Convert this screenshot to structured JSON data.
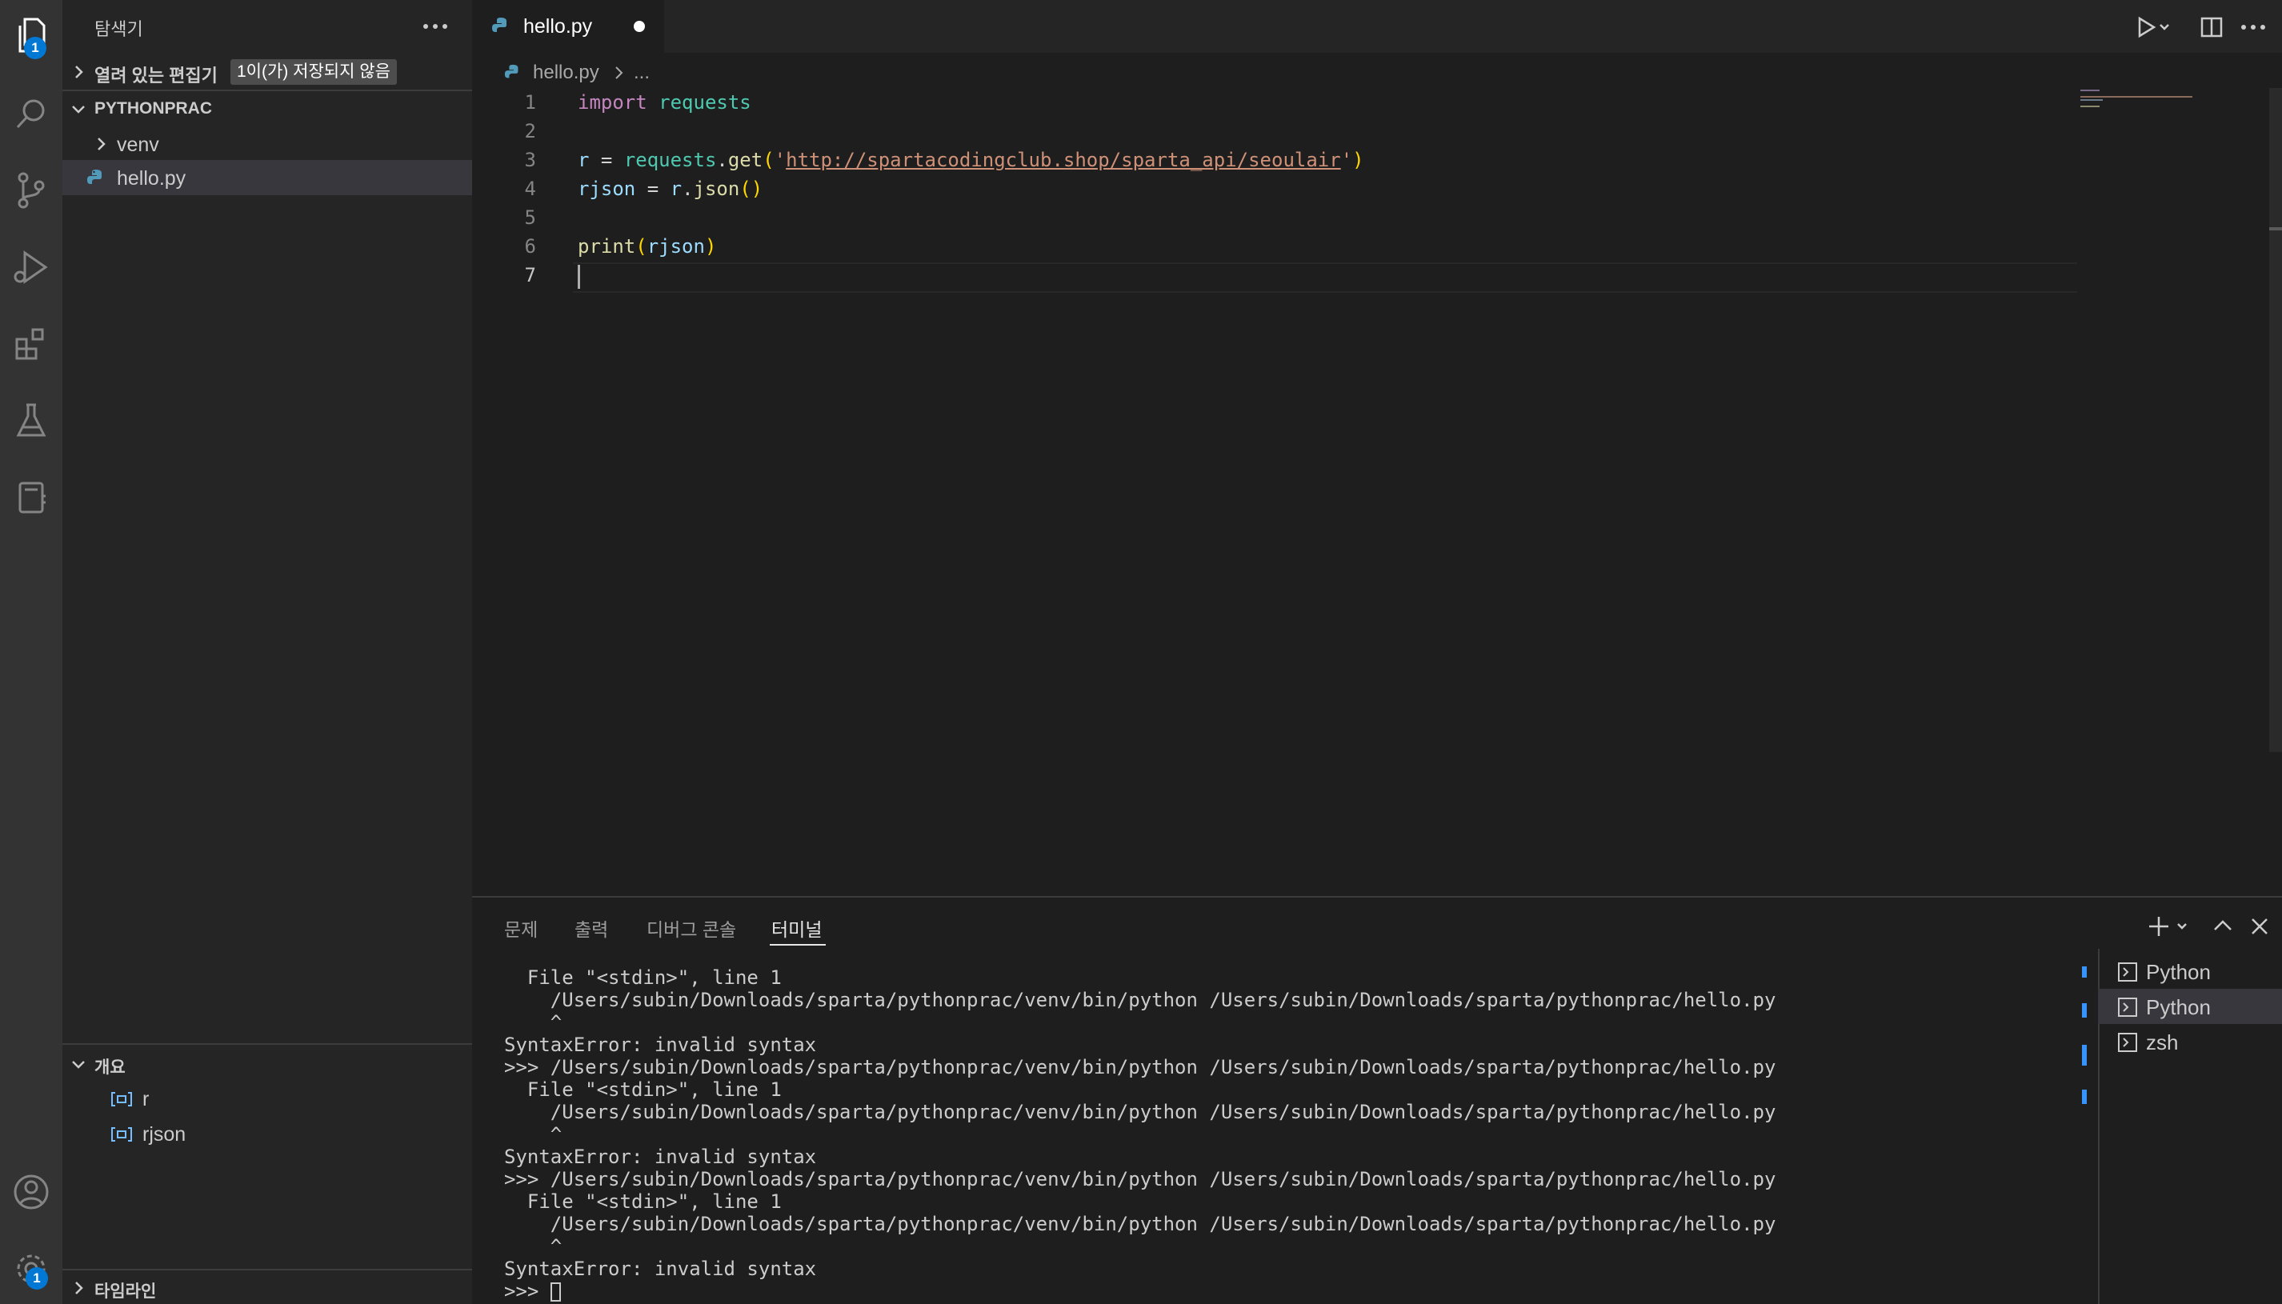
{
  "activity_bar": {
    "explorer_badge": "1",
    "settings_badge": "1",
    "icons": [
      "files-icon",
      "search-icon",
      "source-control-icon",
      "run-debug-icon",
      "extensions-icon",
      "testing-icon",
      "notebook-icon",
      "account-icon",
      "gear-icon"
    ]
  },
  "sidebar": {
    "title": "탐색기",
    "open_editors_label": "열려 있는 편집기",
    "unsaved_badge": "1이(가) 저장되지 않음",
    "folder_name": "PYTHONPRAC",
    "tree": [
      {
        "label": "venv",
        "type": "folder"
      },
      {
        "label": "hello.py",
        "type": "python-file",
        "selected": true
      }
    ],
    "outline_title": "개요",
    "outline_items": [
      "r",
      "rjson"
    ],
    "timeline_title": "타임라인"
  },
  "tabs": [
    {
      "label": "hello.py",
      "dirty": true,
      "active": true
    }
  ],
  "breadcrumb": {
    "file": "hello.py",
    "more": "..."
  },
  "editor": {
    "line_numbers": [
      "1",
      "2",
      "3",
      "4",
      "5",
      "6",
      "7"
    ],
    "l1_import": "import",
    "l1_module": "requests",
    "l3_var": "r",
    "l3_eq": " = ",
    "l3_module": "requests",
    "l3_dot": ".",
    "l3_fn": "get",
    "l3_open": "(",
    "l3_quote_open": "'",
    "l3_url": "http://spartacodingclub.shop/sparta_api/seoulair",
    "l3_quote_close": "'",
    "l3_close": ")",
    "l4_var": "rjson",
    "l4_eq": " = ",
    "l4_obj": "r",
    "l4_dot": ".",
    "l4_fn": "json",
    "l4_parens": "()",
    "l6_fn": "print",
    "l6_open": "(",
    "l6_arg": "rjson",
    "l6_close": ")"
  },
  "panel": {
    "tabs": [
      "문제",
      "출력",
      "디버그 콘솔",
      "터미널"
    ],
    "active_tab": "터미널",
    "terminal_lines": [
      "  File \"<stdin>\", line 1",
      "    /Users/subin/Downloads/sparta/pythonprac/venv/bin/python /Users/subin/Downloads/sparta/pythonprac/hello.py",
      "    ^",
      "SyntaxError: invalid syntax",
      ">>> /Users/subin/Downloads/sparta/pythonprac/venv/bin/python /Users/subin/Downloads/sparta/pythonprac/hello.py",
      "  File \"<stdin>\", line 1",
      "    /Users/subin/Downloads/sparta/pythonprac/venv/bin/python /Users/subin/Downloads/sparta/pythonprac/hello.py",
      "    ^",
      "SyntaxError: invalid syntax",
      ">>> /Users/subin/Downloads/sparta/pythonprac/venv/bin/python /Users/subin/Downloads/sparta/pythonprac/hello.py",
      "  File \"<stdin>\", line 1",
      "    /Users/subin/Downloads/sparta/pythonprac/venv/bin/python /Users/subin/Downloads/sparta/pythonprac/hello.py",
      "    ^",
      "SyntaxError: invalid syntax",
      ">>> "
    ],
    "terminal_instances": [
      "Python",
      "Python",
      "zsh"
    ]
  },
  "colors": {
    "accent": "#0078d4",
    "activity_bar": "#333333",
    "sidebar": "#252526",
    "editor": "#1e1e1e"
  }
}
